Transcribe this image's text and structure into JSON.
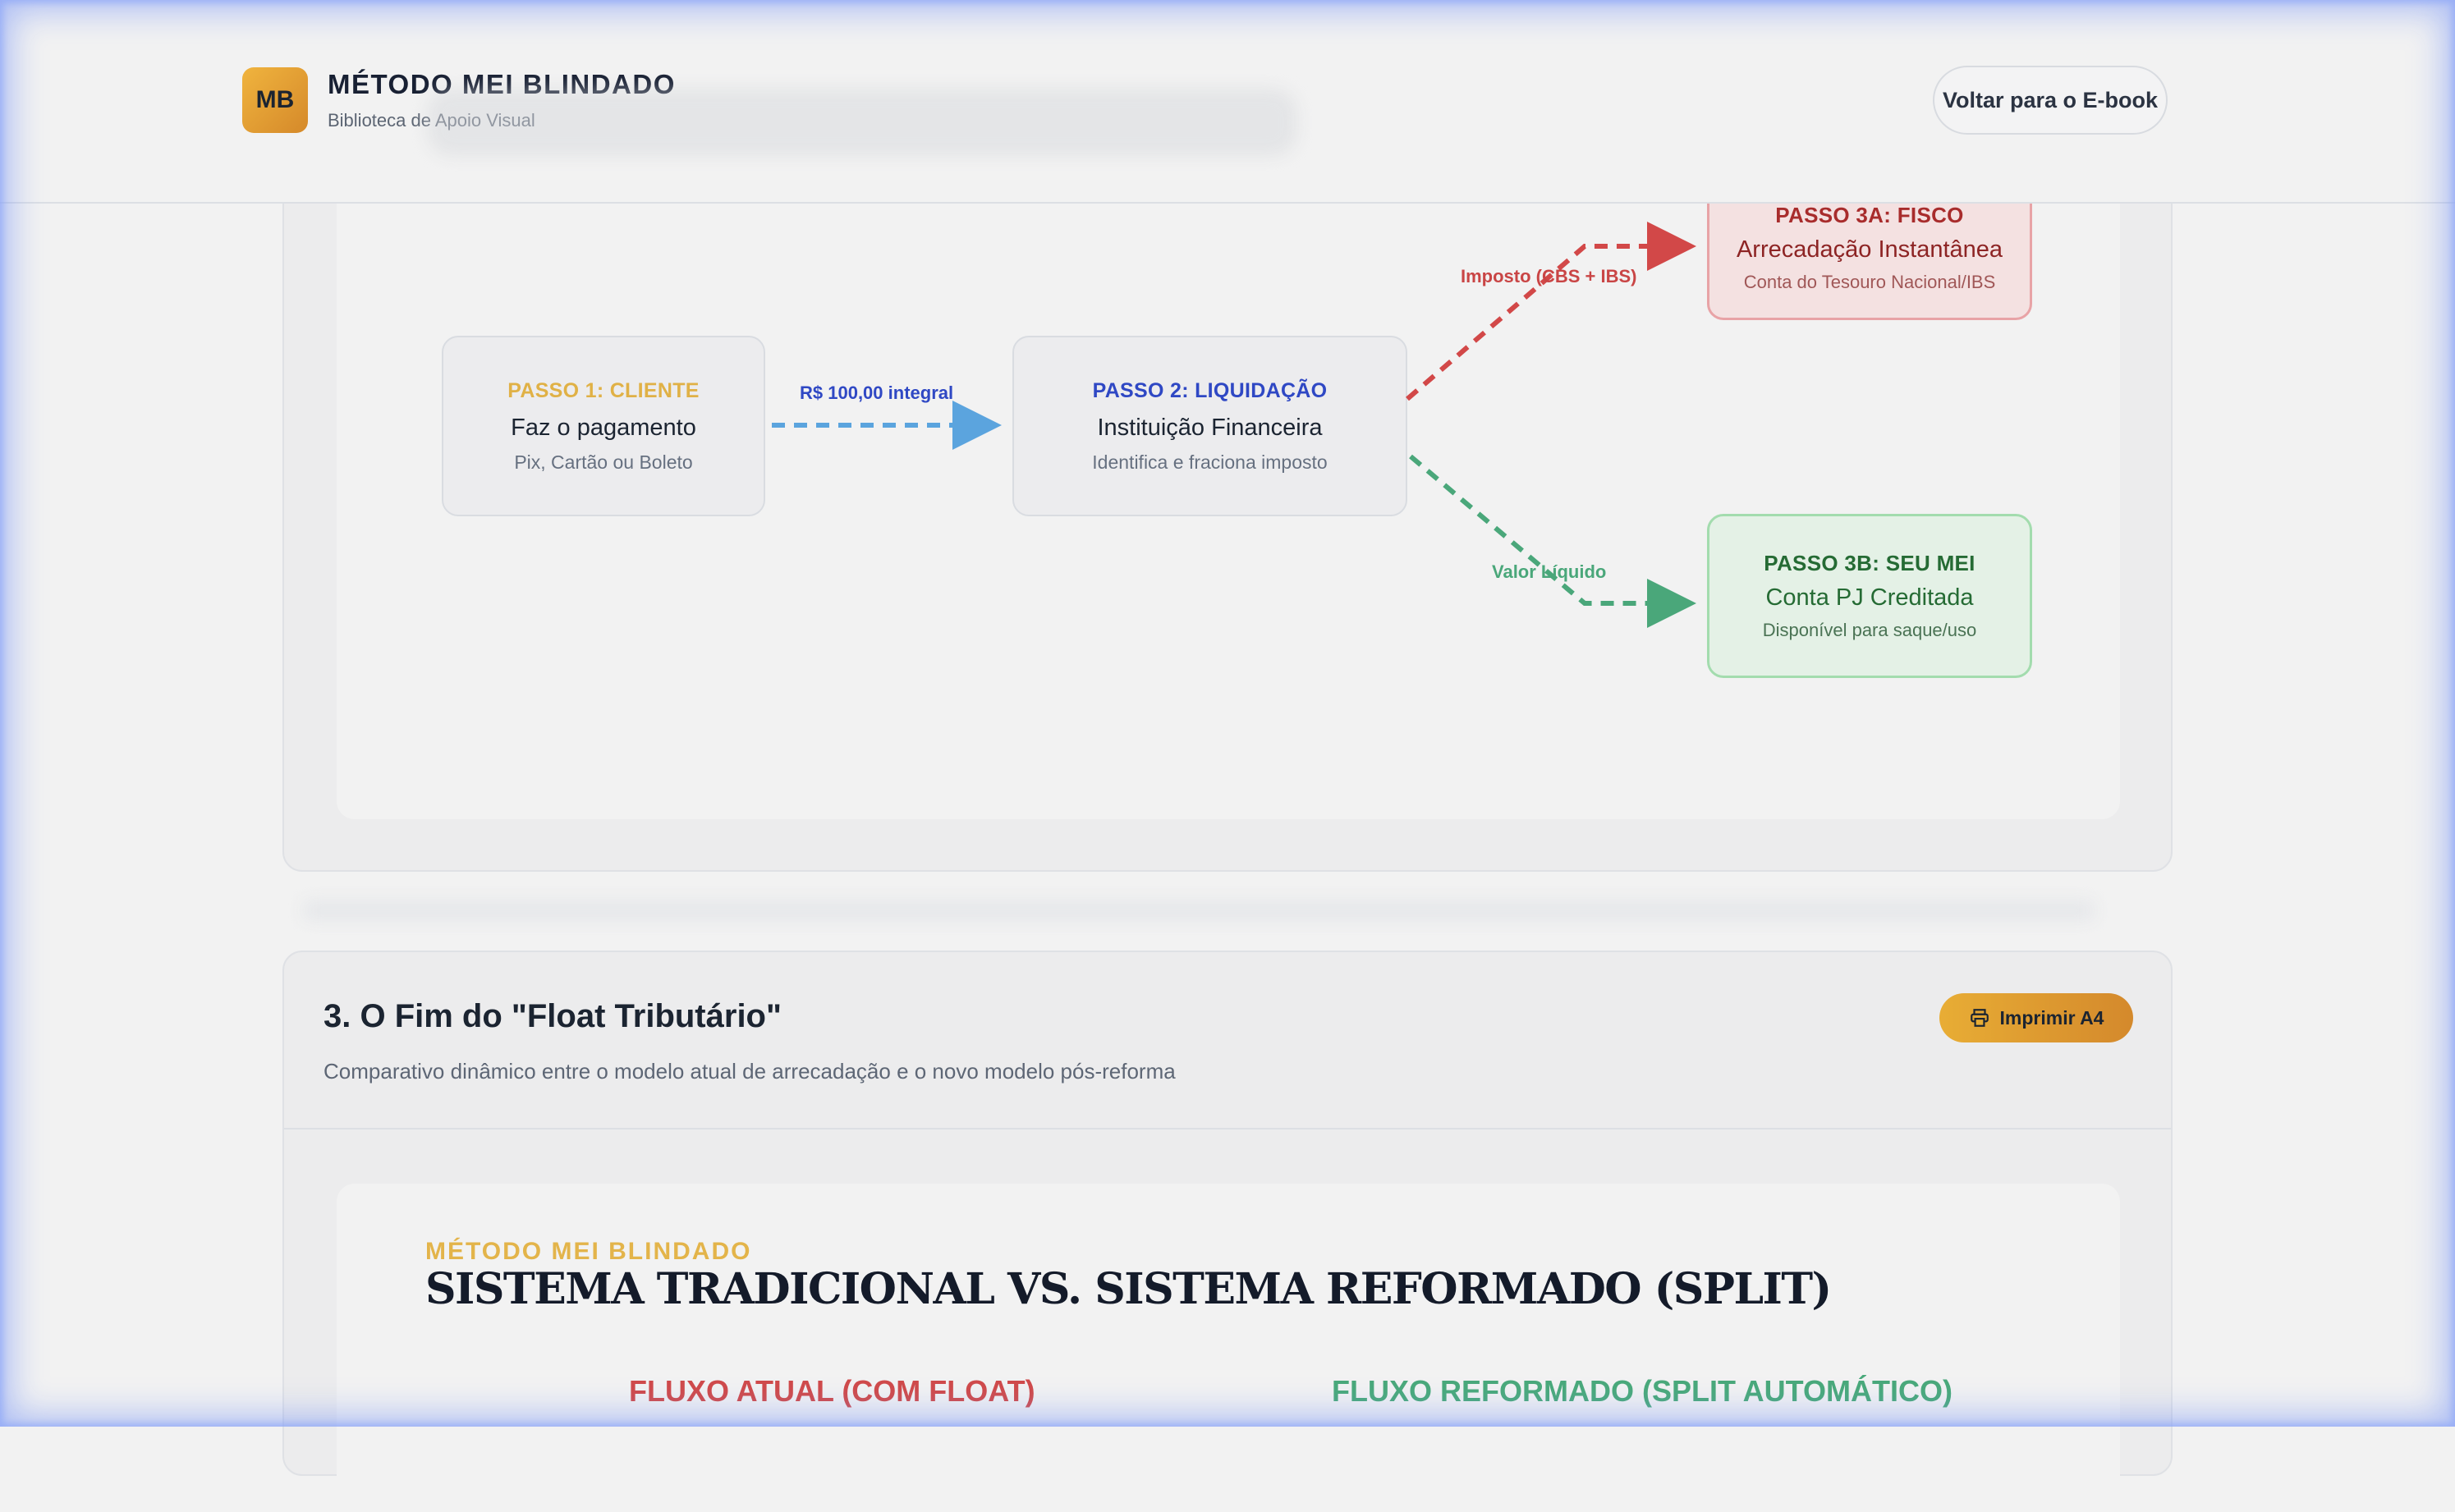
{
  "header": {
    "logo_text": "MB",
    "title": "MÉTODO MEI BLINDADO",
    "subtitle": "Biblioteca de Apoio Visual",
    "back_button": "Voltar para o E-book"
  },
  "flow": {
    "step1": {
      "step": "PASSO 1: CLIENTE",
      "main": "Faz o pagamento",
      "sub": "Pix, Cartão ou Boleto"
    },
    "arrow1_label": "R$ 100,00 integral",
    "step2": {
      "step": "PASSO 2: LIQUIDAÇÃO",
      "main": "Instituição Financeira",
      "sub": "Identifica e fraciona imposto"
    },
    "tax_label": "Imposto (CBS + IBS)",
    "net_label": "Valor Líquido",
    "step3a": {
      "step": "PASSO 3A: FISCO",
      "main": "Arrecadação Instantânea",
      "sub": "Conta do Tesouro Nacional/IBS"
    },
    "step3b": {
      "step": "PASSO 3B: SEU MEI",
      "main": "Conta PJ Creditada",
      "sub": "Disponível para saque/uso"
    }
  },
  "section3": {
    "title": "3. O Fim do \"Float Tributário\"",
    "description": "Comparativo dinâmico entre o modelo atual de arrecadação e o novo modelo pós-reforma",
    "print_button": "Imprimir A4",
    "kicker": "MÉTODO MEI BLINDADO",
    "heading": "SISTEMA TRADICIONAL VS. SISTEMA REFORMADO (SPLIT)",
    "left_flow_title": "FLUXO ATUAL (COM FLOAT)",
    "right_flow_title": "FLUXO REFORMADO (SPLIT AUTOMÁTICO)"
  },
  "colors": {
    "accent_gold": "#e8ad35",
    "blue": "#2f48c4",
    "red": "#d04a4a",
    "green": "#49a97a"
  }
}
